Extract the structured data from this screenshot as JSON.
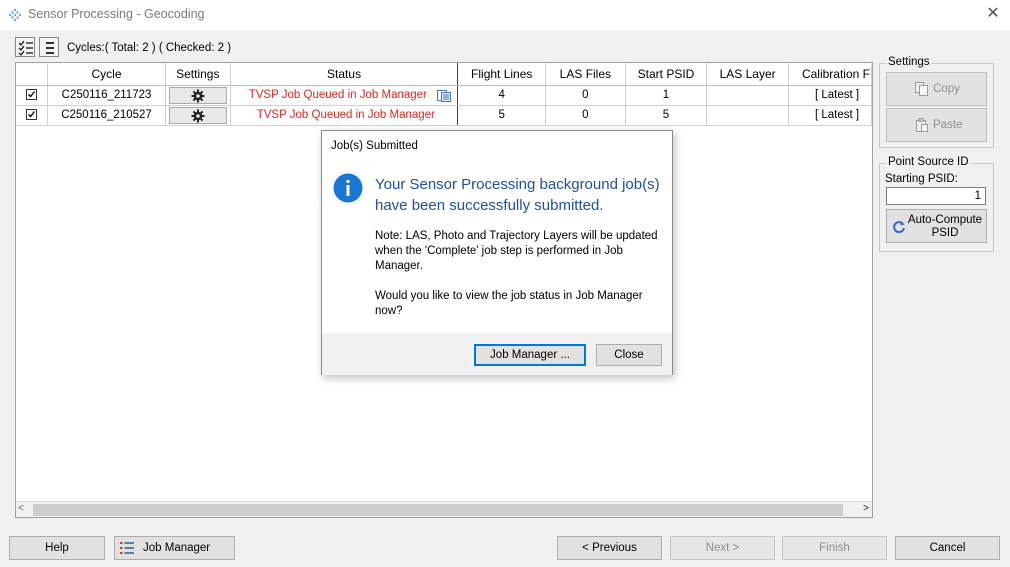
{
  "window": {
    "title": "Sensor Processing - Geocoding"
  },
  "toolbar": {
    "cycles_label": "Cycles:( Total: 2 ) ( Checked: 2 )"
  },
  "grid": {
    "columns": [
      "Cycle",
      "Settings",
      "Status",
      "Flight Lines",
      "LAS Files",
      "Start PSID",
      "LAS Layer",
      "Calibration F"
    ],
    "rows": [
      {
        "checked": true,
        "cycle": "C250116_211723",
        "status": "TVSP Job Queued in Job Manager",
        "flight_lines": "4",
        "las_files": "0",
        "start_psid": "1",
        "las_layer": "",
        "calibration": "[ Latest ]"
      },
      {
        "checked": true,
        "cycle": "C250116_210527",
        "status": "TVSP Job Queued in Job Manager",
        "flight_lines": "5",
        "las_files": "0",
        "start_psid": "5",
        "las_layer": "",
        "calibration": "[ Latest ]"
      }
    ]
  },
  "settings_panel": {
    "legend": "Settings",
    "copy_label": "Copy",
    "paste_label": "Paste"
  },
  "psid_panel": {
    "legend": "Point Source ID",
    "starting_label": "Starting PSID:",
    "starting_value": "1",
    "auto_compute_label": "Auto-Compute PSID"
  },
  "dialog": {
    "title": "Job(s) Submitted",
    "headline": "Your Sensor Processing background job(s) have been successfully submitted.",
    "note": "Note: LAS, Photo and Trajectory Layers will be updated when the 'Complete' job step is performed in Job Manager.",
    "question": "Would you like to view the job status in Job Manager now?",
    "job_manager_label": "Job Manager ...",
    "close_label": "Close"
  },
  "footer": {
    "help_label": "Help",
    "job_manager_label": "Job Manager",
    "previous_label": "< Previous",
    "next_label": "Next >",
    "finish_label": "Finish",
    "cancel_label": "Cancel"
  },
  "colors": {
    "status_text": "#e0261d",
    "dialog_headline": "#1f4fa8",
    "info_icon": "#1976d2",
    "column_highlight": "#1c3cc0"
  }
}
